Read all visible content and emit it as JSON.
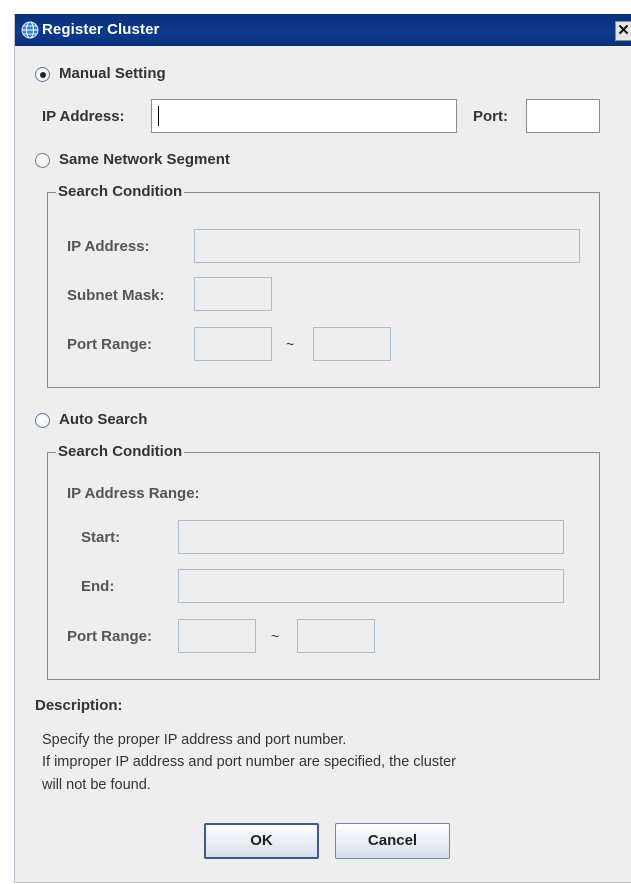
{
  "window": {
    "title": "Register Cluster",
    "close_label": "✕"
  },
  "manual": {
    "label": "Manual Setting",
    "selected": true,
    "ip_label": "IP Address:",
    "ip_value": "",
    "port_label": "Port:",
    "port_value": ""
  },
  "segment": {
    "label": "Same Network Segment",
    "selected": false,
    "group_title": "Search Condition",
    "ip_label": "IP Address:",
    "mask_label": "Subnet Mask:",
    "port_range_label": "Port Range:",
    "tilde": "~"
  },
  "auto": {
    "label": "Auto Search",
    "selected": false,
    "group_title": "Search Condition",
    "range_label": "IP Address Range:",
    "start_label": "Start:",
    "end_label": "End:",
    "port_range_label": "Port Range:",
    "tilde": "~"
  },
  "description": {
    "heading": "Description:",
    "lines": [
      "Specify the proper IP address and port number.",
      "If improper IP address and port number are specified, the cluster",
      "will not be found."
    ]
  },
  "buttons": {
    "ok": "OK",
    "cancel": "Cancel"
  },
  "colors": {
    "titlebar": "#0a2f7a",
    "dialog_bg": "#eeeeee",
    "disabled_border": "#a8bdd6"
  },
  "icons": {
    "title_icon": "globe-icon",
    "close": "close-icon"
  }
}
